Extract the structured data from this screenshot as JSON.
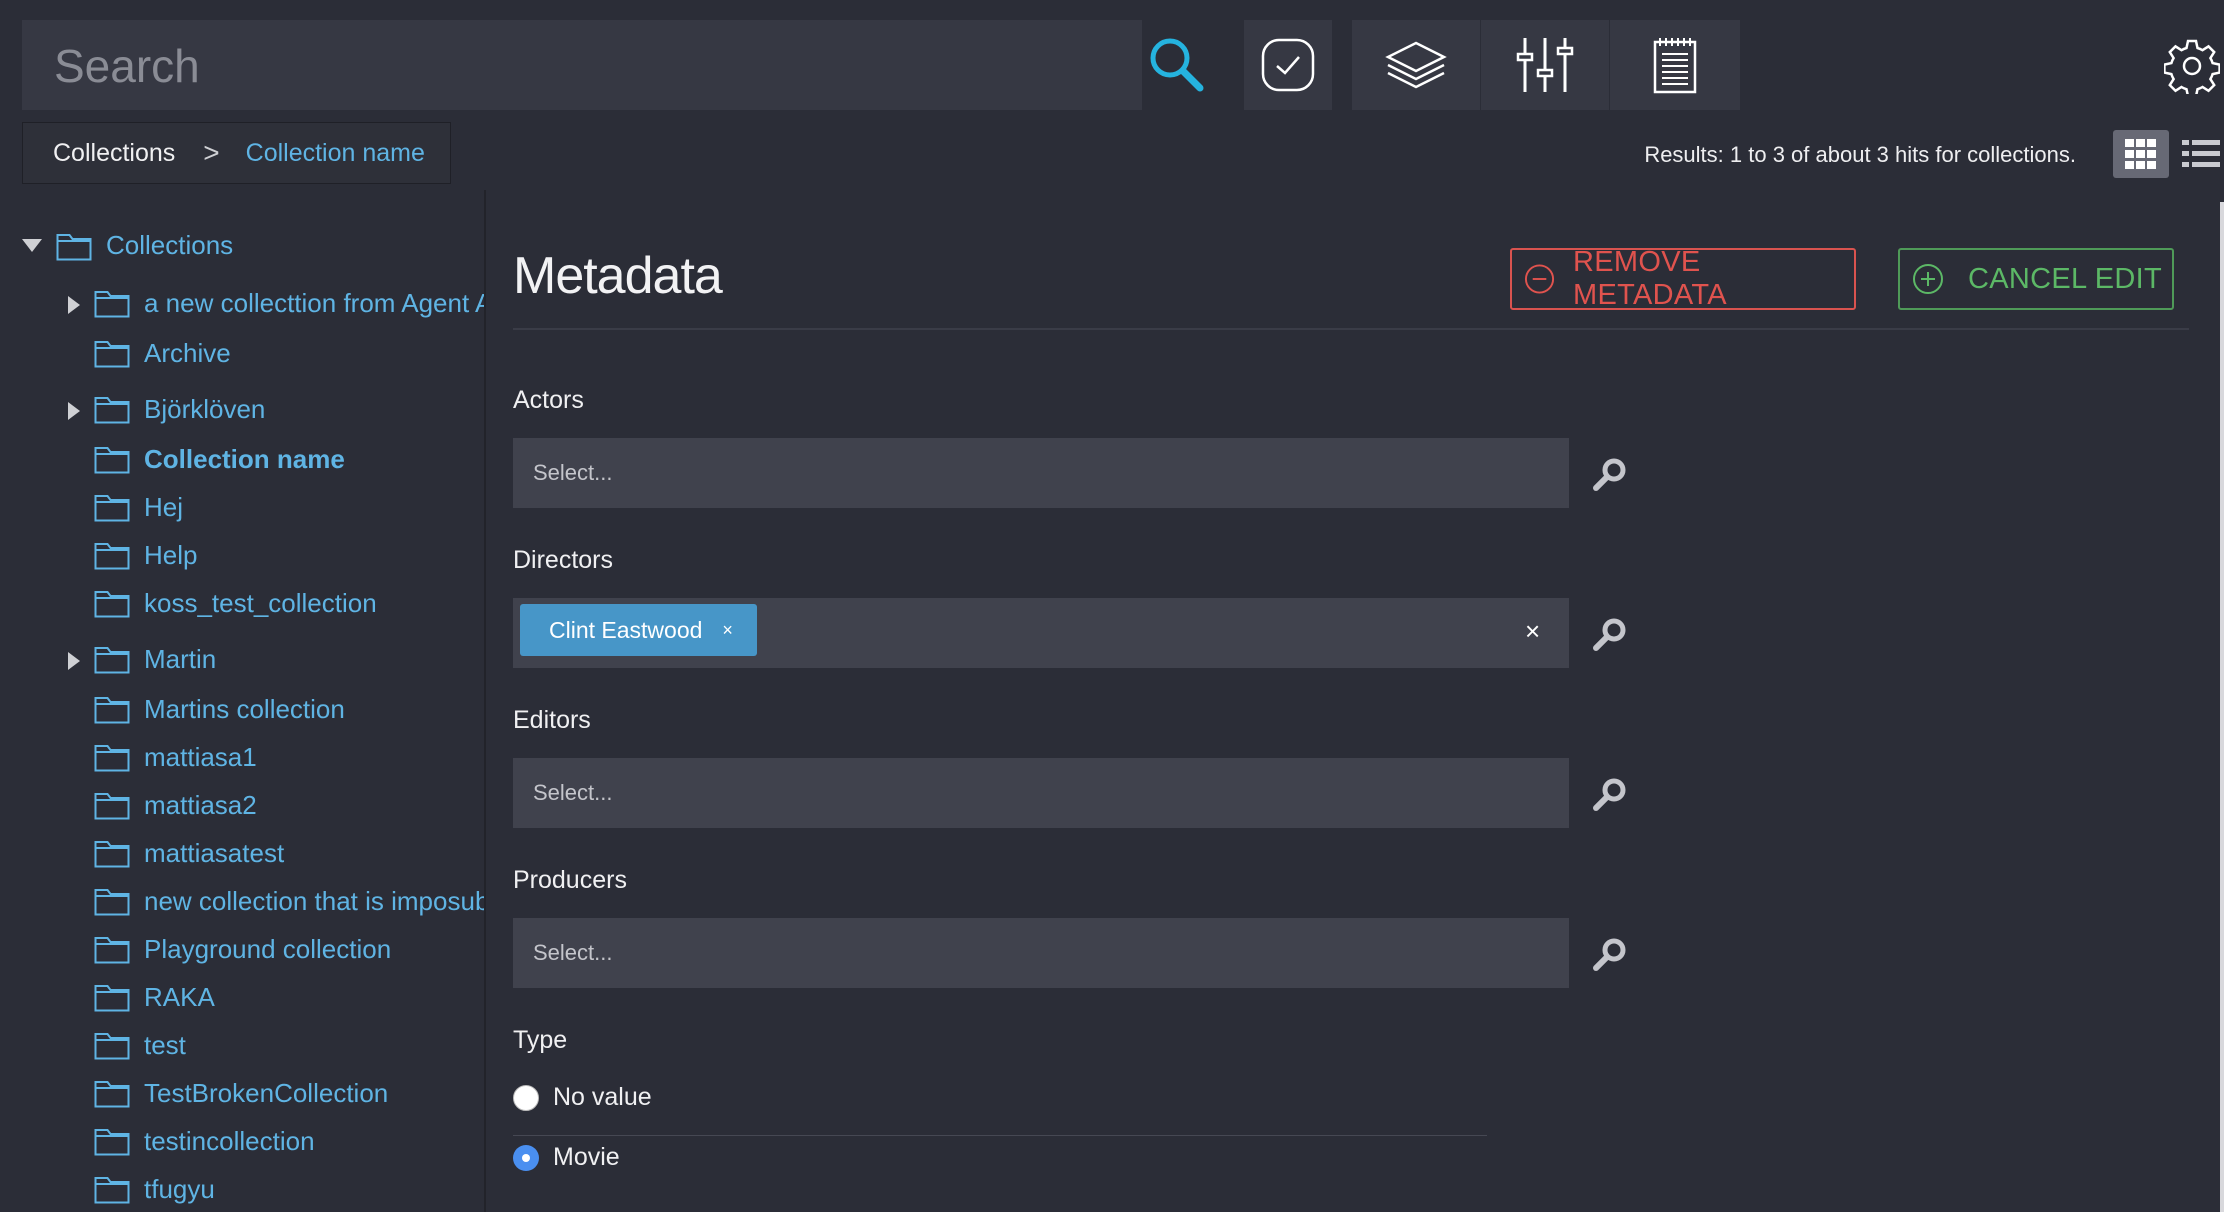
{
  "search": {
    "placeholder": "Search"
  },
  "toolbar": {
    "icons": [
      "search-icon",
      "check-circle-icon",
      "layers-icon",
      "sliders-icon",
      "notepad-icon",
      "gear-icon"
    ]
  },
  "breadcrumb": {
    "root": "Collections",
    "separator": ">",
    "current": "Collection name"
  },
  "results": {
    "text": "Results: 1 to 3 of about 3 hits for collections."
  },
  "sidebar": {
    "root_label": "Collections",
    "items": [
      {
        "label": "a new collecttion from Agent As",
        "has_children": true
      },
      {
        "label": "Archive",
        "has_children": false
      },
      {
        "label": "Björklöven",
        "has_children": true
      },
      {
        "label": "Collection name",
        "has_children": false,
        "selected": true
      },
      {
        "label": "Hej",
        "has_children": false
      },
      {
        "label": "Help",
        "has_children": false
      },
      {
        "label": "koss_test_collection",
        "has_children": false
      },
      {
        "label": "Martin",
        "has_children": true
      },
      {
        "label": "Martins collection",
        "has_children": false
      },
      {
        "label": "mattiasa1",
        "has_children": false
      },
      {
        "label": "mattiasa2",
        "has_children": false
      },
      {
        "label": "mattiasatest",
        "has_children": false
      },
      {
        "label": "new collection that is imposub",
        "has_children": false
      },
      {
        "label": "Playground collection",
        "has_children": false
      },
      {
        "label": "RAKA",
        "has_children": false
      },
      {
        "label": "test",
        "has_children": false
      },
      {
        "label": "TestBrokenCollection",
        "has_children": false
      },
      {
        "label": "testincollection",
        "has_children": false
      },
      {
        "label": "tfugyu",
        "has_children": false
      }
    ]
  },
  "main": {
    "title": "Metadata",
    "remove_label": "REMOVE METADATA",
    "cancel_label": "CANCEL EDIT",
    "fields": {
      "actors": {
        "label": "Actors",
        "placeholder": "Select..."
      },
      "directors": {
        "label": "Directors",
        "tag": "Clint Eastwood",
        "tag_remove": "×",
        "clear": "×"
      },
      "editors": {
        "label": "Editors",
        "placeholder": "Select..."
      },
      "producers": {
        "label": "Producers",
        "placeholder": "Select..."
      }
    },
    "type": {
      "label": "Type",
      "options": [
        {
          "label": "No value",
          "selected": false
        },
        {
          "label": "Movie",
          "selected": true
        }
      ]
    }
  },
  "colors": {
    "background": "#2b2d37",
    "panel": "#363843",
    "link": "#5fb4e4",
    "danger": "#d9534f",
    "success": "#4f9a58",
    "tag": "#4796c8",
    "radio_selected": "#4a8ff0"
  }
}
